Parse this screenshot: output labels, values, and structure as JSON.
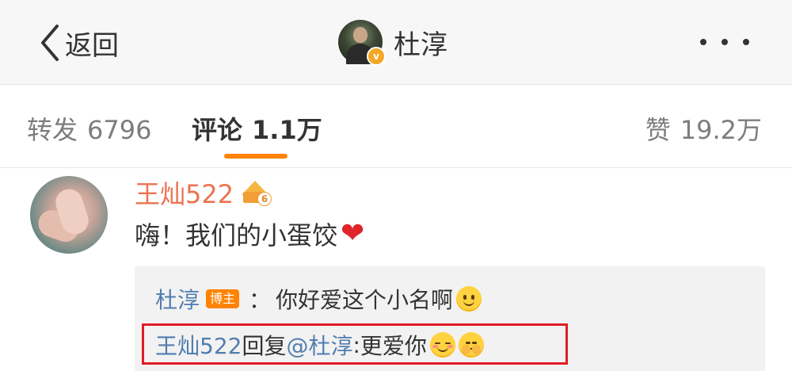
{
  "navbar": {
    "back_label": "返回",
    "title": "杜淳",
    "verified_mark": "v"
  },
  "tabs": {
    "repost_label": "转发",
    "repost_count": "6796",
    "comments_label": "评论",
    "comments_count": "1.1万",
    "likes_label": "赞",
    "likes_count": "19.2万",
    "active_tab": "comments"
  },
  "comment": {
    "user_name": "王灿522",
    "member_level": "6",
    "text": "嗨！我们的小蛋饺",
    "emoji": "red-heart",
    "replies": [
      {
        "user": "杜淳",
        "badge": "博主",
        "separator": "：",
        "text": "你好爱这个小名啊",
        "emoji": "smile"
      },
      {
        "user": "王灿522",
        "reply_word": "回复",
        "mention": "@杜淳",
        "separator": ":",
        "text": "更爱你",
        "emojis": [
          "blush",
          "shy"
        ],
        "highlighted": true
      }
    ]
  },
  "colors": {
    "accent": "#ff8200",
    "username_orange": "#eb7350",
    "link_blue": "#507daf",
    "highlight_red": "#e01d24"
  }
}
